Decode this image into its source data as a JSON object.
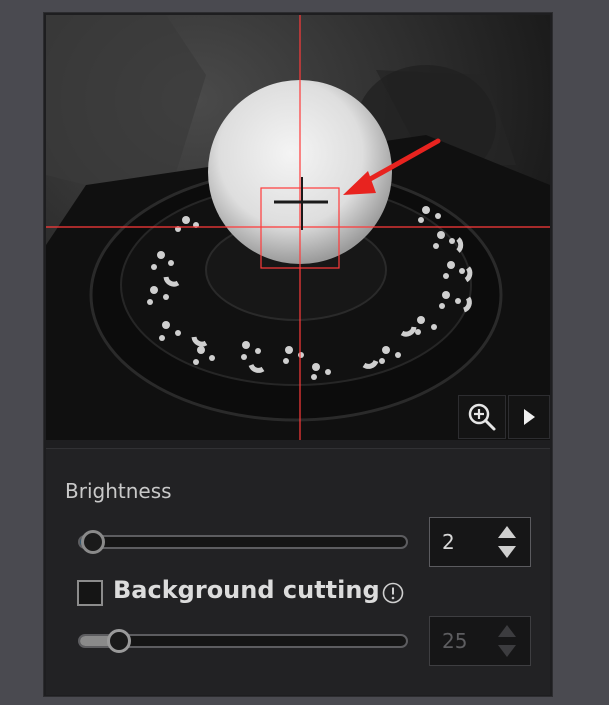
{
  "viewport": {
    "icons": {
      "zoom": "zoom-in-icon",
      "next": "play-triangle-icon"
    }
  },
  "settings": {
    "brightness": {
      "label": "Brightness",
      "value": "2",
      "slider_fraction": 0.04,
      "spinner_enabled": true
    },
    "background_cutting": {
      "label": "Background cutting",
      "checked": false,
      "info_icon": "info-circle-icon",
      "value": "25",
      "slider_fraction": 0.12,
      "spinner_enabled": false
    }
  },
  "colors": {
    "crosshair": "#ff3a3a",
    "annotation_arrow": "#e8231f",
    "slider_accent": "#36607a"
  }
}
